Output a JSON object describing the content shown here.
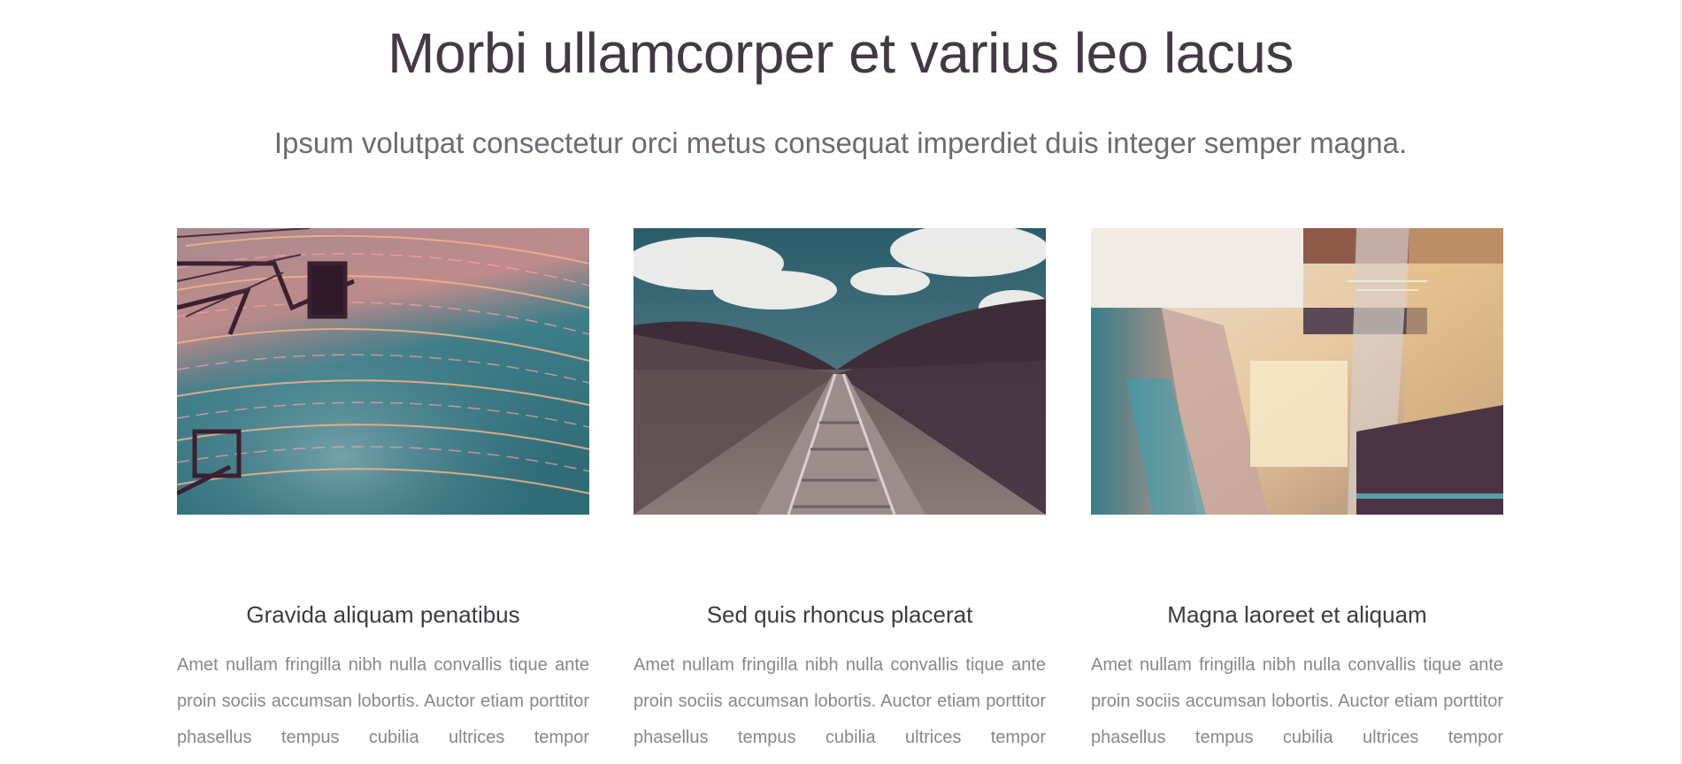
{
  "header": {
    "title": "Morbi ullamcorper et varius leo lacus",
    "subtitle": "Ipsum volutpat consectetur orci metus consequat imperdiet duis integer semper magna."
  },
  "cards": [
    {
      "image": "light-trails-over-water-photo",
      "title": "Gravida aliquam penatibus",
      "text": "Amet nullam fringilla nibh nulla convallis tique ante proin sociis accumsan lobortis. Auctor etiam porttitor phasellus tempus cubilia ultrices tempor"
    },
    {
      "image": "railway-tracks-motion-photo",
      "title": "Sed quis rhoncus placerat",
      "text": "Amet nullam fringilla nibh nulla convallis tique ante proin sociis accumsan lobortis. Auctor etiam porttitor phasellus tempus cubilia ultrices tempor"
    },
    {
      "image": "escalator-station-photo",
      "title": "Magna laoreet et aliquam",
      "text": "Amet nullam fringilla nibh nulla convallis tique ante proin sociis accumsan lobortis. Auctor etiam porttitor phasellus tempus cubilia ultrices tempor"
    }
  ],
  "colors": {
    "title": "#433944",
    "subtitle": "#6f6970",
    "card_title": "#3d3a40",
    "body_text": "#8a868b"
  }
}
